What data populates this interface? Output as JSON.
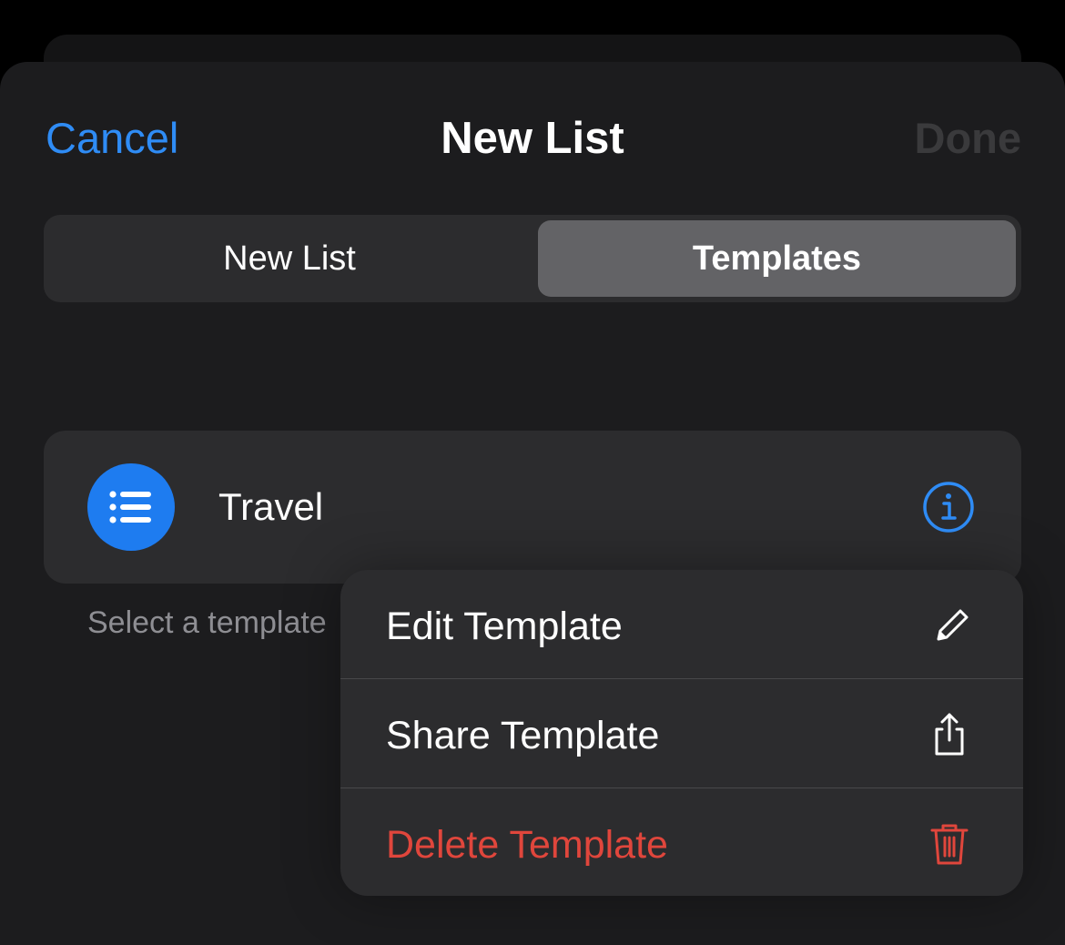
{
  "nav": {
    "cancel_label": "Cancel",
    "title": "New List",
    "done_label": "Done"
  },
  "segmented": {
    "options": [
      "New List",
      "Templates"
    ],
    "selected": "Templates"
  },
  "templates": [
    {
      "name": "Travel",
      "icon": "list-bullet-icon"
    }
  ],
  "footer_text": "Select a template",
  "context_menu": {
    "items": [
      {
        "label": "Edit Template",
        "icon": "pencil-icon",
        "destructive": false
      },
      {
        "label": "Share Template",
        "icon": "share-icon",
        "destructive": false
      },
      {
        "label": "Delete Template",
        "icon": "trash-icon",
        "destructive": true
      }
    ]
  },
  "colors": {
    "accent": "#2f8cf5",
    "destructive": "#e0463c",
    "badge": "#1e7cf0",
    "disabled": "#3a3a3c",
    "sheet_bg": "#1c1c1e",
    "cell_bg": "#2c2c2e",
    "selected_segment": "#636366"
  }
}
